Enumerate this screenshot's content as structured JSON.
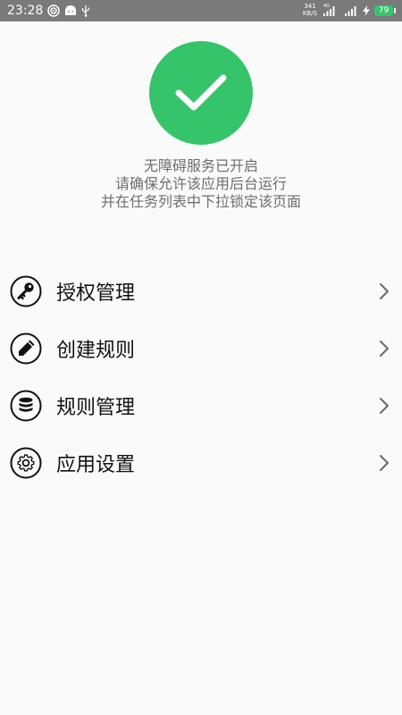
{
  "status_bar": {
    "time": "23:28",
    "net_speed_value": "341",
    "net_speed_unit": "KB/S",
    "network_type": "4G",
    "battery": "79",
    "icons": [
      "hotspot-icon",
      "android-icon",
      "usb-icon",
      "signal-icon",
      "signal-icon",
      "charging-icon",
      "battery-icon"
    ]
  },
  "status": {
    "icon": "check-icon",
    "accent_color": "#35c46a",
    "lines": [
      "无障碍服务已开启",
      "请确保允许该应用后台运行",
      "并在任务列表中下拉锁定该页面"
    ]
  },
  "menu": {
    "items": [
      {
        "label": "授权管理",
        "icon": "key-icon"
      },
      {
        "label": "创建规则",
        "icon": "pencil-icon"
      },
      {
        "label": "规则管理",
        "icon": "database-icon"
      },
      {
        "label": "应用设置",
        "icon": "gear-icon"
      }
    ],
    "chevron_icon": "chevron-right-icon"
  }
}
